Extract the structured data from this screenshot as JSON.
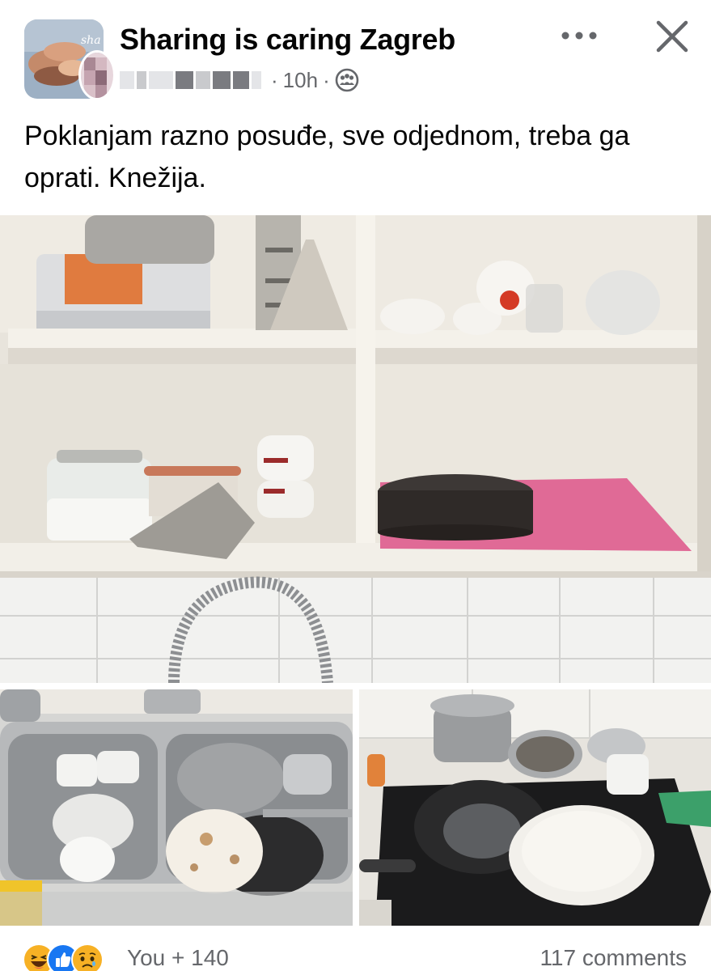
{
  "post": {
    "group_name": "Sharing is caring Zagreb",
    "time": "10h",
    "separator": "·",
    "audience_icon": "group-audience-icon",
    "text": "Poklanjam razno posuđe, sve odjednom, treba ga oprati. Knežija.",
    "more_icon": "more-options-icon",
    "close_icon": "close-icon"
  },
  "photos": [
    {
      "description_icon": "photo-kitchen-cabinet"
    },
    {
      "description_icon": "photo-sink-dishes"
    },
    {
      "description_icon": "photo-stove-pots"
    }
  ],
  "footer": {
    "reactions": [
      "haha",
      "like",
      "sad"
    ],
    "reaction_count": "You + 140",
    "comment_count": "117 comments"
  },
  "colors": {
    "text": "#050505",
    "secondary_text": "#65676b",
    "like_blue": "#1877f2",
    "reaction_yellow": "#f7b125"
  }
}
